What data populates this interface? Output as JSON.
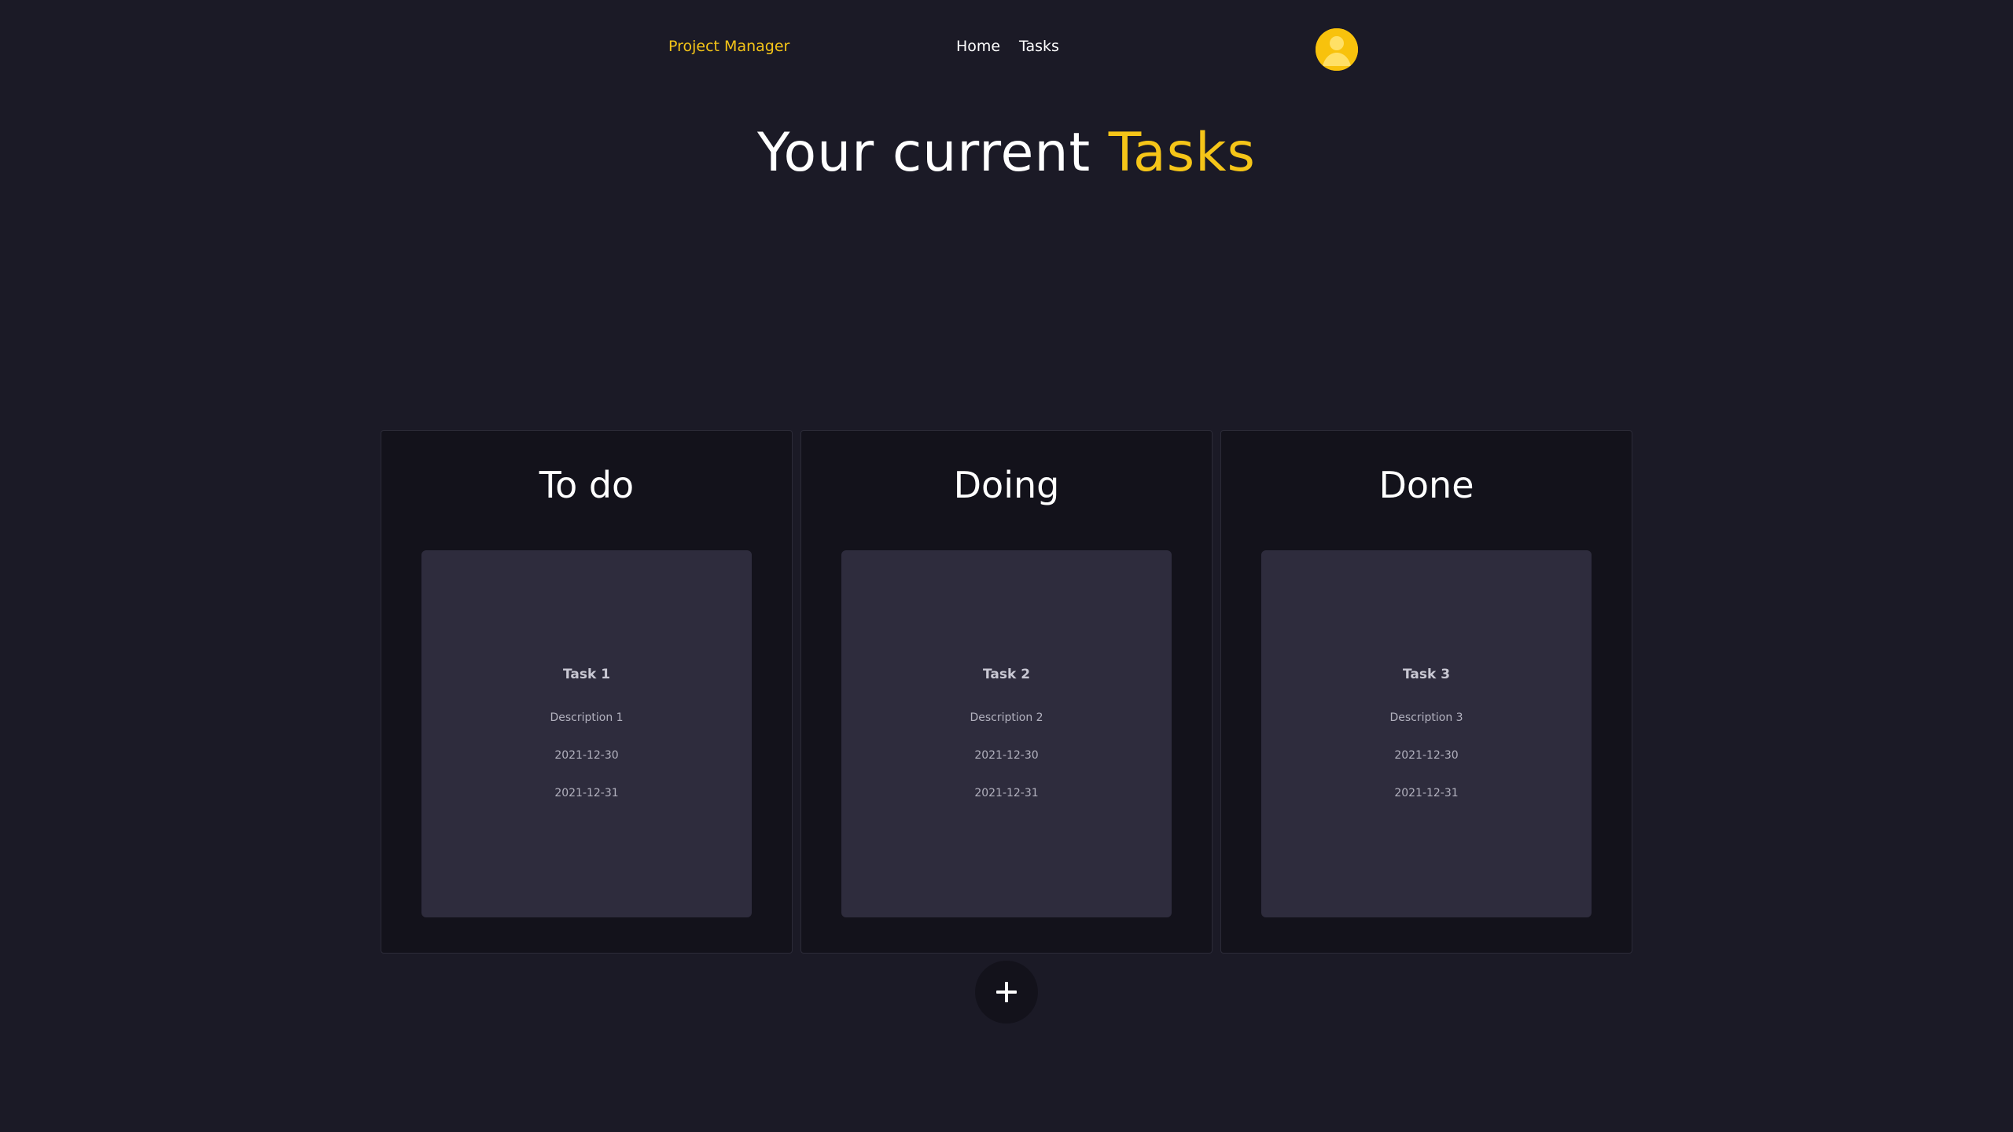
{
  "nav": {
    "brand": "Project Manager",
    "links": [
      "Home",
      "Tasks"
    ],
    "avatar_icon": "user-avatar-icon"
  },
  "headline": {
    "prefix": "Your current ",
    "highlight": "Tasks"
  },
  "columns": [
    {
      "title": "To do",
      "tasks": [
        {
          "title": "Task 1",
          "description": "Description 1",
          "start": "2021-12-30",
          "end": "2021-12-31"
        }
      ]
    },
    {
      "title": "Doing",
      "tasks": [
        {
          "title": "Task 2",
          "description": "Description 2",
          "start": "2021-12-30",
          "end": "2021-12-31"
        }
      ]
    },
    {
      "title": "Done",
      "tasks": [
        {
          "title": "Task 3",
          "description": "Description 3",
          "start": "2021-12-30",
          "end": "2021-12-31"
        }
      ]
    }
  ],
  "add_button": {
    "icon": "plus-icon"
  },
  "colors": {
    "background": "#1b1a26",
    "accent": "#f5c518",
    "column": "#13121b",
    "card": "#2e2c3d"
  }
}
